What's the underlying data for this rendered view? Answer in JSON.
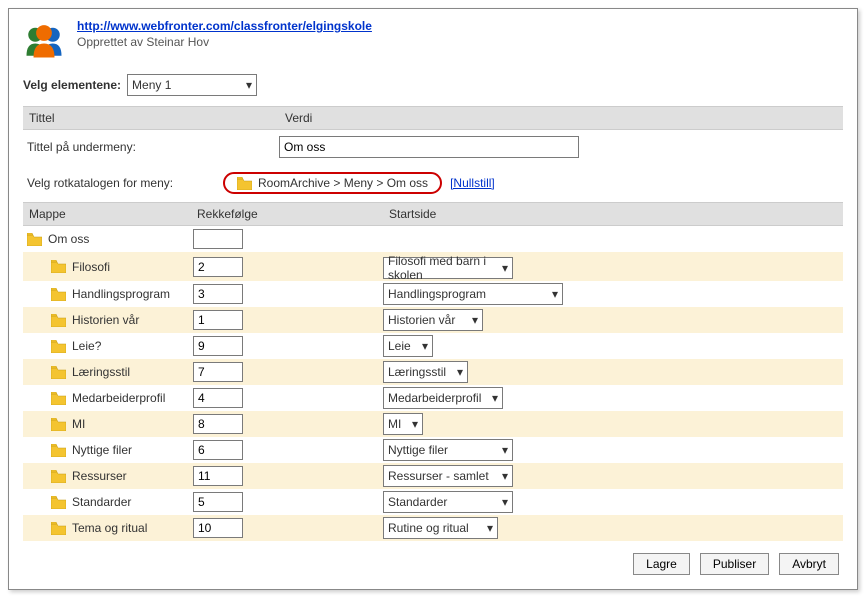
{
  "header": {
    "link": "http://www.webfronter.com/classfronter/elgingskole",
    "created": "Opprettet av Steinar Hov"
  },
  "select_elements": {
    "label": "Velg elementene:",
    "value": "Meny 1"
  },
  "grid": {
    "titles": {
      "tittel": "Tittel",
      "verdi": "Verdi"
    },
    "submenu_label": "Tittel på undermeny:",
    "submenu_value": "Om oss",
    "root_label": "Velg rotkatalogen for meny:",
    "root_path": "RoomArchive > Meny > Om oss",
    "nullstill": "[Nullstill]"
  },
  "categories": {
    "headers": {
      "mappe": "Mappe",
      "rekke": "Rekkefølge",
      "start": "Startside"
    },
    "top_folder": "Om oss",
    "rows": [
      {
        "name": "Filosofi",
        "order": "2",
        "start": "Filosofi med barn i skolen"
      },
      {
        "name": "Handlingsprogram",
        "order": "3",
        "start": "Handlingsprogram"
      },
      {
        "name": "Historien vår",
        "order": "1",
        "start": "Historien vår"
      },
      {
        "name": "Leie?",
        "order": "9",
        "start": "Leie"
      },
      {
        "name": "Læringsstil",
        "order": "7",
        "start": "Læringsstil"
      },
      {
        "name": "Medarbeiderprofil",
        "order": "4",
        "start": "Medarbeiderprofil"
      },
      {
        "name": "MI",
        "order": "8",
        "start": "MI"
      },
      {
        "name": "Nyttige filer",
        "order": "6",
        "start": "Nyttige filer"
      },
      {
        "name": "Ressurser",
        "order": "11",
        "start": "Ressurser - samlet"
      },
      {
        "name": "Standarder",
        "order": "5",
        "start": "Standarder"
      },
      {
        "name": "Tema og ritual",
        "order": "10",
        "start": "Rutine og ritual"
      }
    ]
  },
  "buttons": {
    "lagre": "Lagre",
    "publiser": "Publiser",
    "avbryt": "Avbryt"
  },
  "dropdown_widths": [
    130,
    180,
    100,
    50,
    85,
    120,
    40,
    130,
    130,
    130,
    115
  ]
}
